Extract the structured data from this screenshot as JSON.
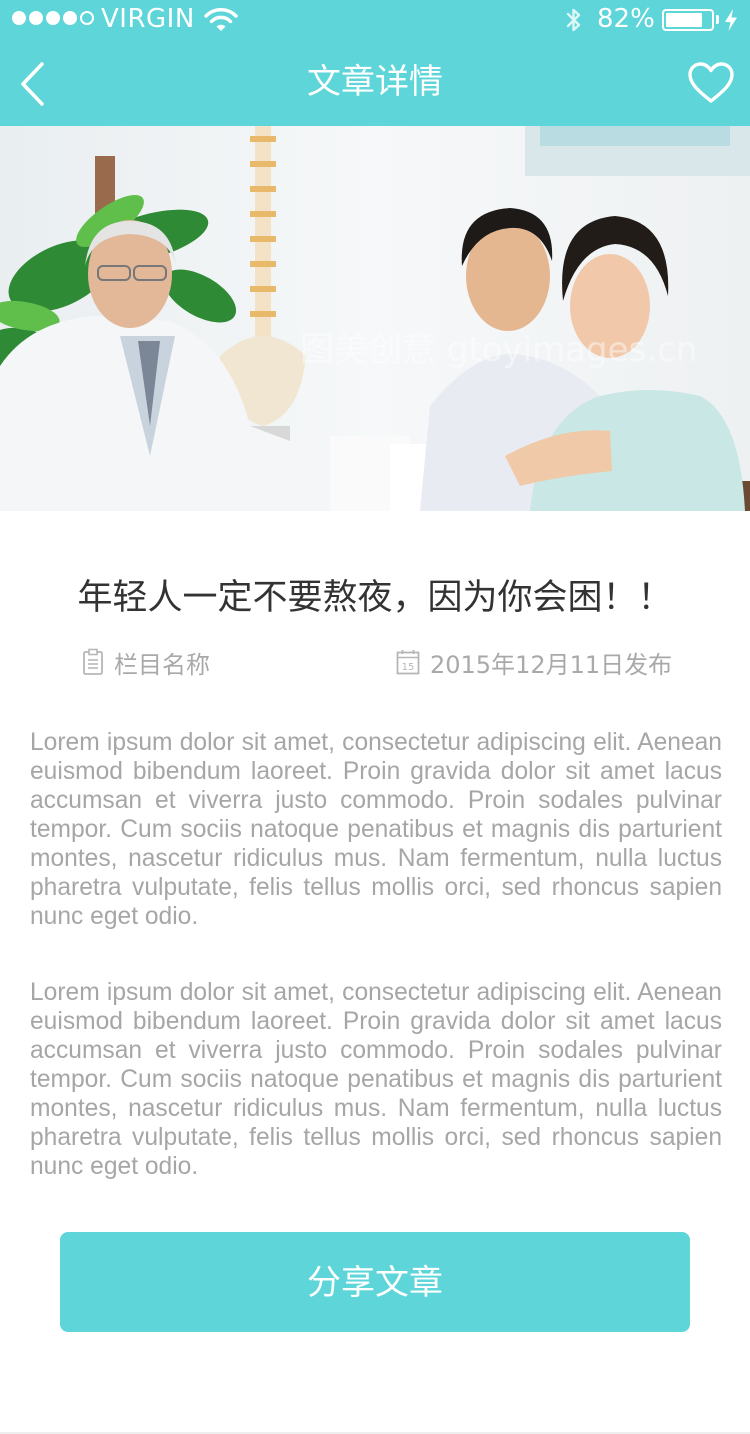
{
  "status_bar": {
    "carrier": "VIRGIN",
    "battery_percent": "82%",
    "battery_level": 0.82
  },
  "nav": {
    "title": "文章详情",
    "back_icon": "chevron-left-icon",
    "favorite_icon": "heart-outline-icon"
  },
  "hero": {
    "image": "photo of doctor with young couple at desk",
    "watermark": "图美创意 gtoyimages.cn"
  },
  "article": {
    "title": "年轻人一定不要熬夜，因为你会困！！",
    "category": "栏目名称",
    "publish_date": "2015年12月11日发布",
    "paragraphs": [
      "Lorem ipsum dolor sit amet, consectetur adipiscing elit. Aenean euismod bibendum laoreet. Proin gravida dolor sit amet lacus accumsan et viverra justo commodo. Proin sodales pulvinar tempor. Cum sociis natoque penatibus et magnis dis parturient montes, nascetur ridiculus mus. Nam fermentum, nulla luctus pharetra vulputate, felis tellus mollis orci, sed rhoncus sapien nunc eget odio.",
      "Lorem ipsum dolor sit amet, consectetur adipiscing elit. Aenean euismod bibendum laoreet. Proin gravida dolor sit amet lacus accumsan et viverra justo commodo. Proin sodales pulvinar tempor. Cum sociis natoque penatibus et magnis dis parturient montes, nascetur ridiculus mus. Nam fermentum, nulla luctus pharetra vulputate, felis tellus mollis orci, sed rhoncus sapien nunc eget odio."
    ]
  },
  "share_button": {
    "label": "分享文章"
  },
  "colors": {
    "accent": "#5dd5d9",
    "title_text": "#333333",
    "body_text": "#a6a6a6",
    "meta_text": "#a9a9a9"
  }
}
